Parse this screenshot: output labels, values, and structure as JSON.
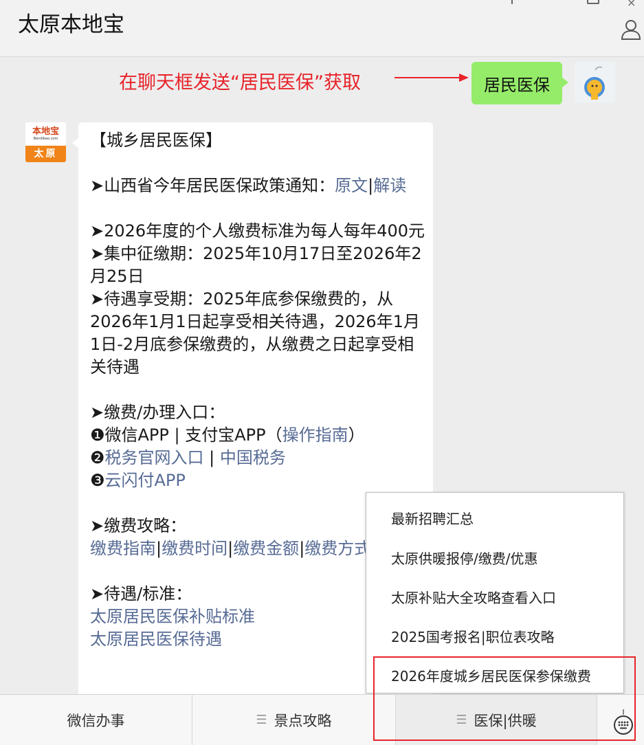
{
  "header": {
    "title": "太原本地宝"
  },
  "tip": {
    "text": "在聊天框发送“居民医保”获取"
  },
  "user_message": {
    "text": "居民医保"
  },
  "bot_avatar": {
    "logo": "本地宝",
    "domain": "Bendibao.com",
    "city": "太原"
  },
  "message": {
    "title": "【城乡居民医保】",
    "policy_prefix": "➤山西省今年居民医保政策通知：",
    "policy_link1": "原文",
    "policy_sep": "|",
    "policy_link2": "解读",
    "fee_standard": "➤2026年度的个人缴费标准为每人每年400元",
    "collect_period": "➤集中征缴期：2025年10月17日至2026年2月25日",
    "benefit_period": "➤待遇享受期：2025年底参保缴费的，从2026年1月1日起享受相关待遇，2026年1月1日-2月底参保缴费的，从缴费之日起享受相关待遇",
    "entry_title": "➤缴费/办理入口：",
    "entry1_bullet": "❶",
    "entry1_text": "微信APP | 支付宝APP（",
    "entry1_link": "操作指南",
    "entry1_close": "）",
    "entry2_bullet": "❷",
    "entry2_link1": "税务官网入口",
    "entry2_sep": " | ",
    "entry2_link2": "中国税务",
    "entry3_bullet": "❸",
    "entry3_link": "云闪付APP",
    "guide_title": "➤缴费攻略：",
    "guide_links": [
      "缴费指南",
      "缴费时间",
      "缴费金额",
      "缴费方式"
    ],
    "benefit_title": "➤待遇/标准：",
    "benefit_link1": "太原居民医保补贴标准",
    "benefit_link2": "太原居民医保待遇"
  },
  "popup_menu": {
    "items": [
      "最新招聘汇总",
      "太原供暖报停/缴费/优惠",
      "太原补贴大全攻略查看入口",
      "2025国考报名|职位表攻略",
      "2026年度城乡居民医保参保缴费"
    ]
  },
  "bottom_bar": {
    "tab1": "微信办事",
    "tab2": "景点攻略",
    "tab3": "医保|供暖",
    "menu_icon": "menu-lines-icon",
    "keyboard_icon": "keyboard-icon"
  },
  "colors": {
    "tip_red": "#e8232a",
    "link_blue": "#576b95",
    "bubble_green": "#95ec69",
    "brand_orange": "#f08418"
  }
}
